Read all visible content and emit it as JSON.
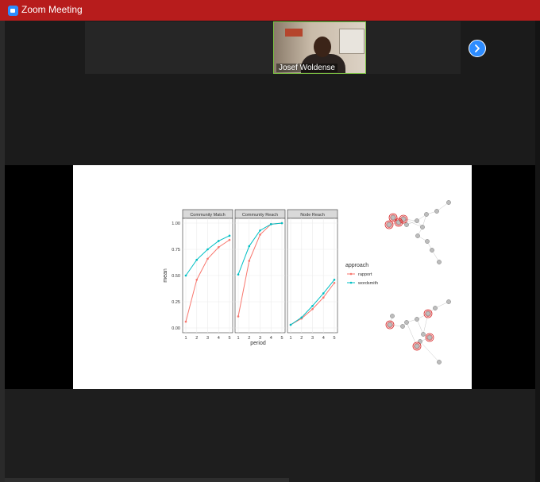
{
  "window": {
    "title": "Zoom Meeting"
  },
  "participants": [
    {
      "name": "Josef Woldense"
    }
  ],
  "slide": {
    "chart_data": {
      "type": "line",
      "facets": [
        "Community Match",
        "Community Reach",
        "Node Reach"
      ],
      "x": [
        1,
        2,
        3,
        4,
        5
      ],
      "xlabel": "period",
      "ylabel": "mean",
      "ylim": [
        0,
        1
      ],
      "yticks": [
        "0.00",
        "0.25",
        "0.50",
        "0.75",
        "1.00"
      ],
      "xticks": [
        "1",
        "2",
        "3",
        "4",
        "5"
      ],
      "legend_title": "approach",
      "legend_position": "right",
      "series": [
        {
          "name": "rapport",
          "color": "#f8766d",
          "values": [
            [
              0.06,
              0.46,
              0.66,
              0.77,
              0.84
            ],
            [
              0.11,
              0.64,
              0.89,
              0.99,
              1.0
            ],
            [
              0.03,
              0.09,
              0.18,
              0.29,
              0.43
            ]
          ]
        },
        {
          "name": "wordsmith",
          "color": "#00bfc4",
          "values": [
            [
              0.5,
              0.65,
              0.75,
              0.83,
              0.88
            ],
            [
              0.51,
              0.78,
              0.93,
              0.99,
              1.0
            ],
            [
              0.03,
              0.1,
              0.21,
              0.33,
              0.46
            ]
          ]
        }
      ]
    }
  }
}
